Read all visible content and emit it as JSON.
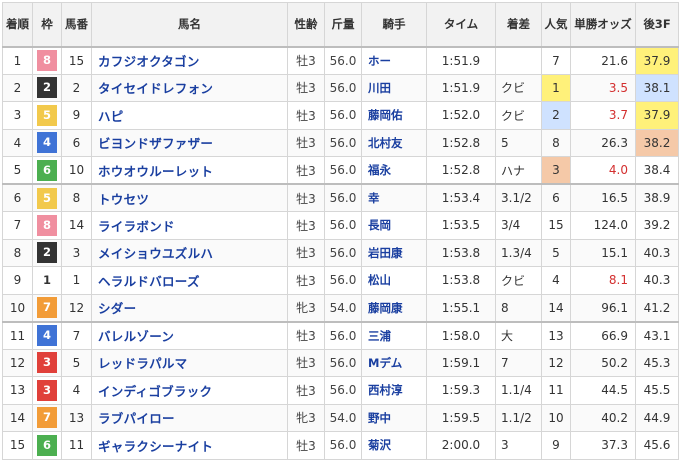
{
  "headers": {
    "pos": "着順",
    "waku": "枠",
    "umaban": "馬番",
    "horse": "馬名",
    "sexage": "性齢",
    "weight": "斤量",
    "jockey": "騎手",
    "time": "タイム",
    "margin": "着差",
    "pop": "人気",
    "odds": "単勝オッズ",
    "last3f": "後3F"
  },
  "waku_colors": {
    "1": {
      "bg": "#ffffff",
      "fg": "#333333"
    },
    "2": {
      "bg": "#333333",
      "fg": "#ffffff"
    },
    "3": {
      "bg": "#e0403a",
      "fg": "#ffffff"
    },
    "4": {
      "bg": "#3f73d6",
      "fg": "#ffffff"
    },
    "5": {
      "bg": "#f2c94c",
      "fg": "#ffffff"
    },
    "6": {
      "bg": "#4caf50",
      "fg": "#ffffff"
    },
    "7": {
      "bg": "#f29c38",
      "fg": "#ffffff"
    },
    "8": {
      "bg": "#f08fa0",
      "fg": "#ffffff"
    }
  },
  "highlight_colors": {
    "gold": "#fff17a",
    "blue": "#cfe2ff",
    "peach": "#f5c9a8",
    "odds_red": "#d32f2f"
  },
  "rows": [
    {
      "pos": "1",
      "waku": "8",
      "umaban": "15",
      "horse": "カフジオクタゴン",
      "sexage": "牡3",
      "weight": "56.0",
      "jockey": "ホー",
      "time": "1:51.9",
      "margin": "",
      "pop": "7",
      "odds": "21.6",
      "last3f": "37.9",
      "pop_hl": "",
      "odds_red": false,
      "last3f_hl": "gold"
    },
    {
      "pos": "2",
      "waku": "2",
      "umaban": "2",
      "horse": "タイセイドレフォン",
      "sexage": "牡3",
      "weight": "56.0",
      "jockey": "川田",
      "time": "1:51.9",
      "margin": "クビ",
      "pop": "1",
      "odds": "3.5",
      "last3f": "38.1",
      "pop_hl": "gold",
      "odds_red": true,
      "last3f_hl": "blue"
    },
    {
      "pos": "3",
      "waku": "5",
      "umaban": "9",
      "horse": "ハピ",
      "sexage": "牡3",
      "weight": "56.0",
      "jockey": "藤岡佑",
      "time": "1:52.0",
      "margin": "クビ",
      "pop": "2",
      "odds": "3.7",
      "last3f": "37.9",
      "pop_hl": "blue",
      "odds_red": true,
      "last3f_hl": "gold"
    },
    {
      "pos": "4",
      "waku": "4",
      "umaban": "6",
      "horse": "ビヨンドザファザー",
      "sexage": "牡3",
      "weight": "56.0",
      "jockey": "北村友",
      "time": "1:52.8",
      "margin": "5",
      "pop": "8",
      "odds": "26.3",
      "last3f": "38.2",
      "pop_hl": "",
      "odds_red": false,
      "last3f_hl": "peach"
    },
    {
      "pos": "5",
      "waku": "6",
      "umaban": "10",
      "horse": "ホウオウルーレット",
      "sexage": "牡3",
      "weight": "56.0",
      "jockey": "福永",
      "time": "1:52.8",
      "margin": "ハナ",
      "pop": "3",
      "odds": "4.0",
      "last3f": "38.4",
      "pop_hl": "peach",
      "odds_red": true,
      "last3f_hl": ""
    },
    {
      "pos": "6",
      "waku": "5",
      "umaban": "8",
      "horse": "トウセツ",
      "sexage": "牡3",
      "weight": "56.0",
      "jockey": "幸",
      "time": "1:53.4",
      "margin": "3.1/2",
      "pop": "6",
      "odds": "16.5",
      "last3f": "38.9",
      "pop_hl": "",
      "odds_red": false,
      "last3f_hl": ""
    },
    {
      "pos": "7",
      "waku": "8",
      "umaban": "14",
      "horse": "ライラボンド",
      "sexage": "牡3",
      "weight": "56.0",
      "jockey": "長岡",
      "time": "1:53.5",
      "margin": "3/4",
      "pop": "15",
      "odds": "124.0",
      "last3f": "39.2",
      "pop_hl": "",
      "odds_red": false,
      "last3f_hl": ""
    },
    {
      "pos": "8",
      "waku": "2",
      "umaban": "3",
      "horse": "メイショウユズルハ",
      "sexage": "牡3",
      "weight": "56.0",
      "jockey": "岩田康",
      "time": "1:53.8",
      "margin": "1.3/4",
      "pop": "5",
      "odds": "15.1",
      "last3f": "40.3",
      "pop_hl": "",
      "odds_red": false,
      "last3f_hl": ""
    },
    {
      "pos": "9",
      "waku": "1",
      "umaban": "1",
      "horse": "ヘラルドバローズ",
      "sexage": "牡3",
      "weight": "56.0",
      "jockey": "松山",
      "time": "1:53.8",
      "margin": "クビ",
      "pop": "4",
      "odds": "8.1",
      "last3f": "40.3",
      "pop_hl": "",
      "odds_red": true,
      "last3f_hl": ""
    },
    {
      "pos": "10",
      "waku": "7",
      "umaban": "12",
      "horse": "シダー",
      "sexage": "牝3",
      "weight": "54.0",
      "jockey": "藤岡康",
      "time": "1:55.1",
      "margin": "8",
      "pop": "14",
      "odds": "96.1",
      "last3f": "41.2",
      "pop_hl": "",
      "odds_red": false,
      "last3f_hl": ""
    },
    {
      "pos": "11",
      "waku": "4",
      "umaban": "7",
      "horse": "バレルゾーン",
      "sexage": "牡3",
      "weight": "56.0",
      "jockey": "三浦",
      "time": "1:58.0",
      "margin": "大",
      "pop": "13",
      "odds": "66.9",
      "last3f": "43.1",
      "pop_hl": "",
      "odds_red": false,
      "last3f_hl": ""
    },
    {
      "pos": "12",
      "waku": "3",
      "umaban": "5",
      "horse": "レッドラパルマ",
      "sexage": "牡3",
      "weight": "56.0",
      "jockey": "Mデム",
      "time": "1:59.1",
      "margin": "7",
      "pop": "12",
      "odds": "50.2",
      "last3f": "45.3",
      "pop_hl": "",
      "odds_red": false,
      "last3f_hl": ""
    },
    {
      "pos": "13",
      "waku": "3",
      "umaban": "4",
      "horse": "インディゴブラック",
      "sexage": "牡3",
      "weight": "56.0",
      "jockey": "西村淳",
      "time": "1:59.3",
      "margin": "1.1/4",
      "pop": "11",
      "odds": "44.5",
      "last3f": "45.5",
      "pop_hl": "",
      "odds_red": false,
      "last3f_hl": ""
    },
    {
      "pos": "14",
      "waku": "7",
      "umaban": "13",
      "horse": "ラブパイロー",
      "sexage": "牝3",
      "weight": "54.0",
      "jockey": "野中",
      "time": "1:59.5",
      "margin": "1.1/2",
      "pop": "10",
      "odds": "40.2",
      "last3f": "44.9",
      "pop_hl": "",
      "odds_red": false,
      "last3f_hl": ""
    },
    {
      "pos": "15",
      "waku": "6",
      "umaban": "11",
      "horse": "ギャラクシーナイト",
      "sexage": "牡3",
      "weight": "56.0",
      "jockey": "菊沢",
      "time": "2:00.0",
      "margin": "3",
      "pop": "9",
      "odds": "37.3",
      "last3f": "45.6",
      "pop_hl": "",
      "odds_red": false,
      "last3f_hl": ""
    }
  ]
}
